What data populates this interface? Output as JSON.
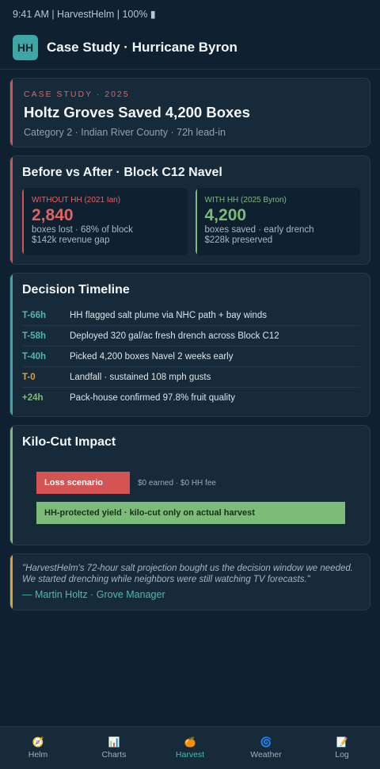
{
  "status_bar": {
    "text": "9:41 AM | HarvestHelm | 100% ▮"
  },
  "header": {
    "logo": "HH",
    "title": "Case Study · Hurricane Byron"
  },
  "hero": {
    "eyebrow": "Case Study · 2025",
    "title": "Holtz Groves Saved 4,200 Boxes",
    "subtitle": "Category 2 · Indian River County · 72h lead-in"
  },
  "compare": {
    "title": "Before vs After · Block C12 Navel",
    "without": {
      "label": "WITHOUT HH (2021 Ian)",
      "value": "2,840",
      "line1": "boxes lost · 68% of block",
      "line2": "$142k revenue gap"
    },
    "with": {
      "label": "WITH HH (2025 Byron)",
      "value": "4,200",
      "line1": "boxes saved · early drench",
      "line2": "$228k preserved"
    }
  },
  "timeline": {
    "title": "Decision Timeline",
    "events": [
      {
        "time": "T-66h",
        "text": "HH flagged salt plume via NHC path + bay winds"
      },
      {
        "time": "T-58h",
        "text": "Deployed 320 gal/ac fresh drench across Block C12"
      },
      {
        "time": "T-40h",
        "text": "Picked 4,200 boxes Navel 2 weeks early"
      },
      {
        "time": "T-0",
        "text": "Landfall · sustained 108 mph gusts"
      },
      {
        "time": "+24h",
        "text": "Pack-house confirmed 97.8% fruit quality"
      }
    ]
  },
  "kilo": {
    "title": "Kilo-Cut Impact",
    "loss_label": "Loss scenario",
    "loss_note": "$0 earned · $0 HH fee",
    "protected_label": "HH-protected yield · kilo-cut only on actual harvest"
  },
  "quote": {
    "text": "\"HarvestHelm's 72-hour salt projection bought us the decision window we needed. We started drenching while neighbors were still watching TV forecasts.\"",
    "author": "— Martin Holtz · Grove Manager"
  },
  "nav": {
    "items": [
      {
        "icon": "🧭",
        "label": "Helm"
      },
      {
        "icon": "📊",
        "label": "Charts"
      },
      {
        "icon": "🍊",
        "label": "Harvest"
      },
      {
        "icon": "🌀",
        "label": "Weather"
      },
      {
        "icon": "📝",
        "label": "Log"
      }
    ]
  },
  "colors": {
    "accent_red": "#e06464",
    "accent_green": "#7cbc78",
    "accent_teal": "#4fb8b1",
    "accent_amber": "#e0a030"
  }
}
